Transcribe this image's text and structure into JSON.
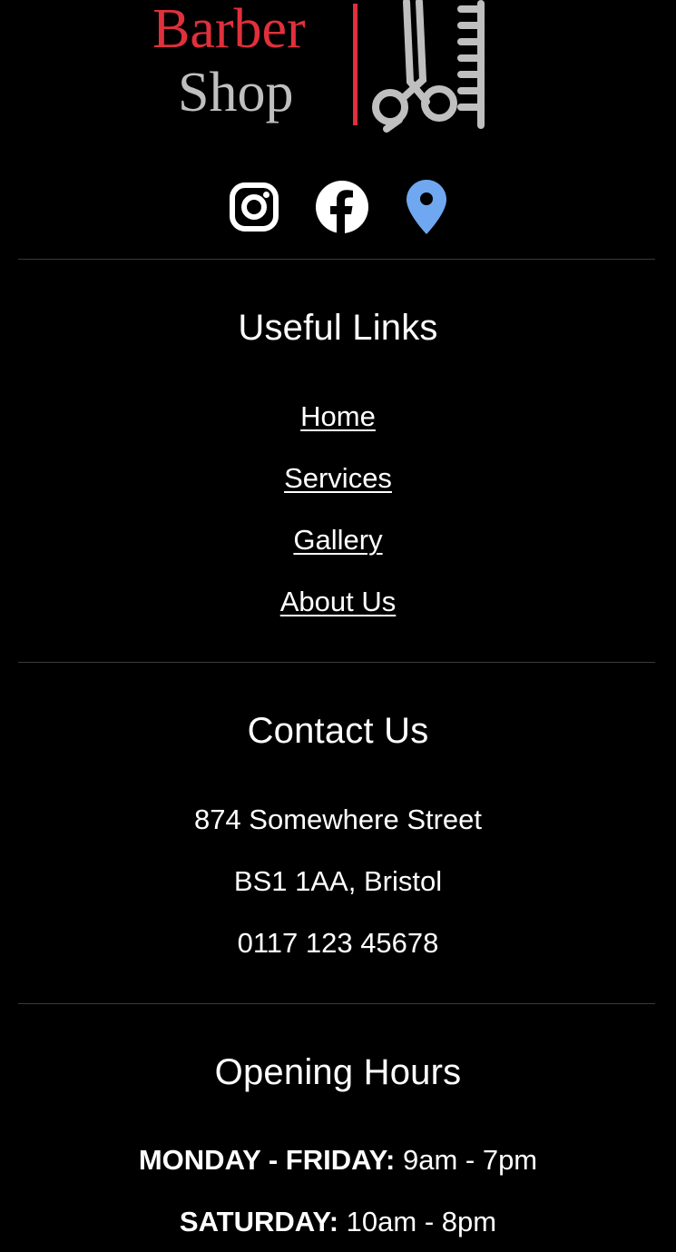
{
  "logo": {
    "word1": "Barber",
    "word2": "Shop",
    "word1_color": "#e0303c",
    "word2_color": "#bfbfbf",
    "divider_color": "#e0303c",
    "icon": "scissors-comb-icon"
  },
  "social": [
    {
      "name": "instagram-icon",
      "color": "#ffffff"
    },
    {
      "name": "facebook-icon",
      "color": "#ffffff"
    },
    {
      "name": "map-pin-icon",
      "color": "#6fa8f0"
    }
  ],
  "useful_links": {
    "title": "Useful Links",
    "links": [
      "Home",
      "Services",
      "Gallery",
      "About Us"
    ]
  },
  "contact": {
    "title": "Contact Us",
    "address_line1": "874 Somewhere Street",
    "address_line2": "BS1 1AA, Bristol",
    "phone": "0117 123 45678"
  },
  "hours": {
    "title": "Opening Hours",
    "rows": [
      {
        "days": "MONDAY - FRIDAY:",
        "time": "9am - 7pm"
      },
      {
        "days": "SATURDAY:",
        "time": "10am - 8pm"
      }
    ]
  }
}
